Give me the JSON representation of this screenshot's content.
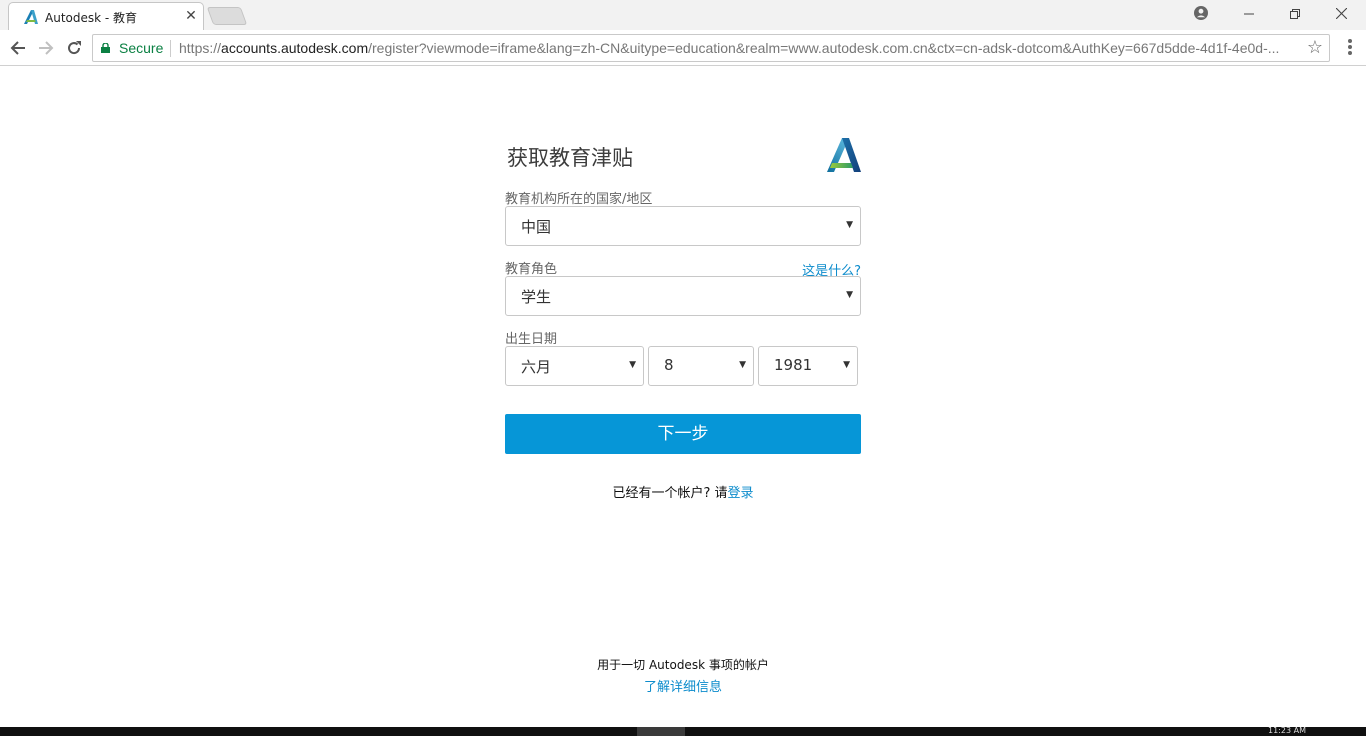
{
  "browser": {
    "tab_title": "Autodesk - 教育",
    "tab_close": "✕",
    "secure_label": "Secure",
    "url_scheme": "https://",
    "url_host": "accounts.autodesk.com",
    "url_rest": "/register?viewmode=iframe&lang=zh-CN&uitype=education&realm=www.autodesk.com.cn&ctx=cn-adsk-dotcom&AuthKey=667d5dde-4d1f-4e0d-...",
    "icons": [
      "back-arrow-icon",
      "forward-arrow-icon",
      "reload-icon",
      "lock-icon",
      "star-icon",
      "menu-icon",
      "profile-icon"
    ]
  },
  "form": {
    "title": "获取教育津贴",
    "country_label": "教育机构所在的国家/地区",
    "country_value": "中国",
    "role_label": "教育角色",
    "role_help": "这是什么?",
    "role_value": "学生",
    "dob_label": "出生日期",
    "dob_month": "六月",
    "dob_day": "8",
    "dob_year": "1981",
    "next_button": "下一步",
    "login_prompt": "已经有一个帐户? 请",
    "login_link": "登录"
  },
  "footer": {
    "line": "用于一切 Autodesk 事项的帐户",
    "link": "了解详细信息"
  },
  "taskbar": {
    "clock": "11:23 AM"
  },
  "colors": {
    "accent": "#0696d7",
    "link": "#0d8ccc",
    "secure": "#0b8043"
  }
}
